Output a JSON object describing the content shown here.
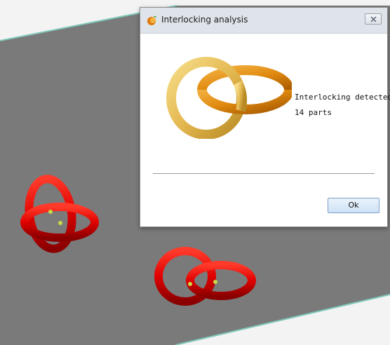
{
  "dialog": {
    "title": "Interlocking analysis",
    "message_line1": "Interlocking detected:",
    "message_line2": "14 parts",
    "ok_label": "Ok",
    "close_icon": "close-icon",
    "app_icon": "app-logo-icon"
  },
  "colors": {
    "viewport_plane": "#7a7a7a",
    "viewport_background": "#f3f3f3",
    "plane_edge": "#7fc7b8",
    "ring_red": "#e00000",
    "ring_gold": "#e8c060",
    "ring_orange": "#e08a10",
    "marker_yellow": "#c8d84a",
    "titlebar": "#dfe4ea"
  }
}
